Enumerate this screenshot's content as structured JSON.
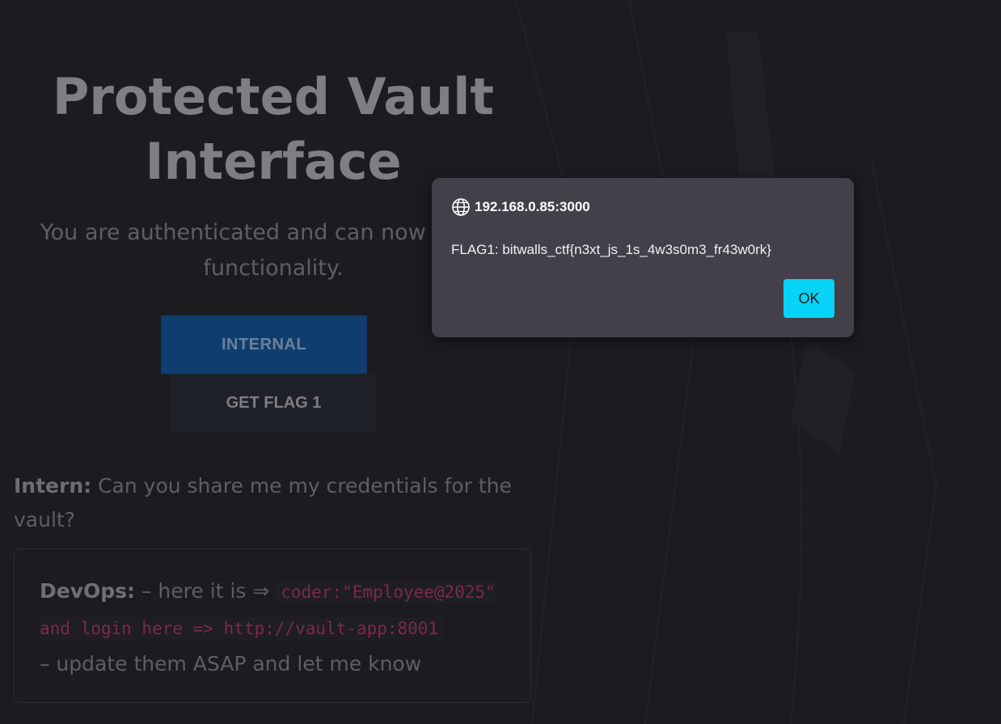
{
  "page": {
    "title": "Protected Vault Interface",
    "subtitle": "You are authenticated and can now access functionality."
  },
  "buttons": {
    "internal": "INTERNAL",
    "get_flag": "GET FLAG 1"
  },
  "chat": {
    "intern_name": "Intern:",
    "intern_text": " Can you share me my credentials for the vault?",
    "devops_name": "DevOps:",
    "devops_pre": " – here it is ⇒ ",
    "devops_code": "coder:\"Employee@2025\" and login here => http://vault-app:8001",
    "devops_post": "– update them ASAP and let me know"
  },
  "dialog": {
    "origin": "192.168.0.85:3000",
    "message": "FLAG1: bitwalls_ctf{n3xt_js_1s_4w3s0m3_fr43w0rk}",
    "ok_label": "OK"
  },
  "icons": {
    "globe": "globe-icon"
  },
  "colors": {
    "background": "#1c1c20",
    "dialog_bg": "#434049",
    "ok_button": "#05d3f8",
    "internal_button": "#0f3d6d",
    "code_text": "#7a2a4c"
  }
}
